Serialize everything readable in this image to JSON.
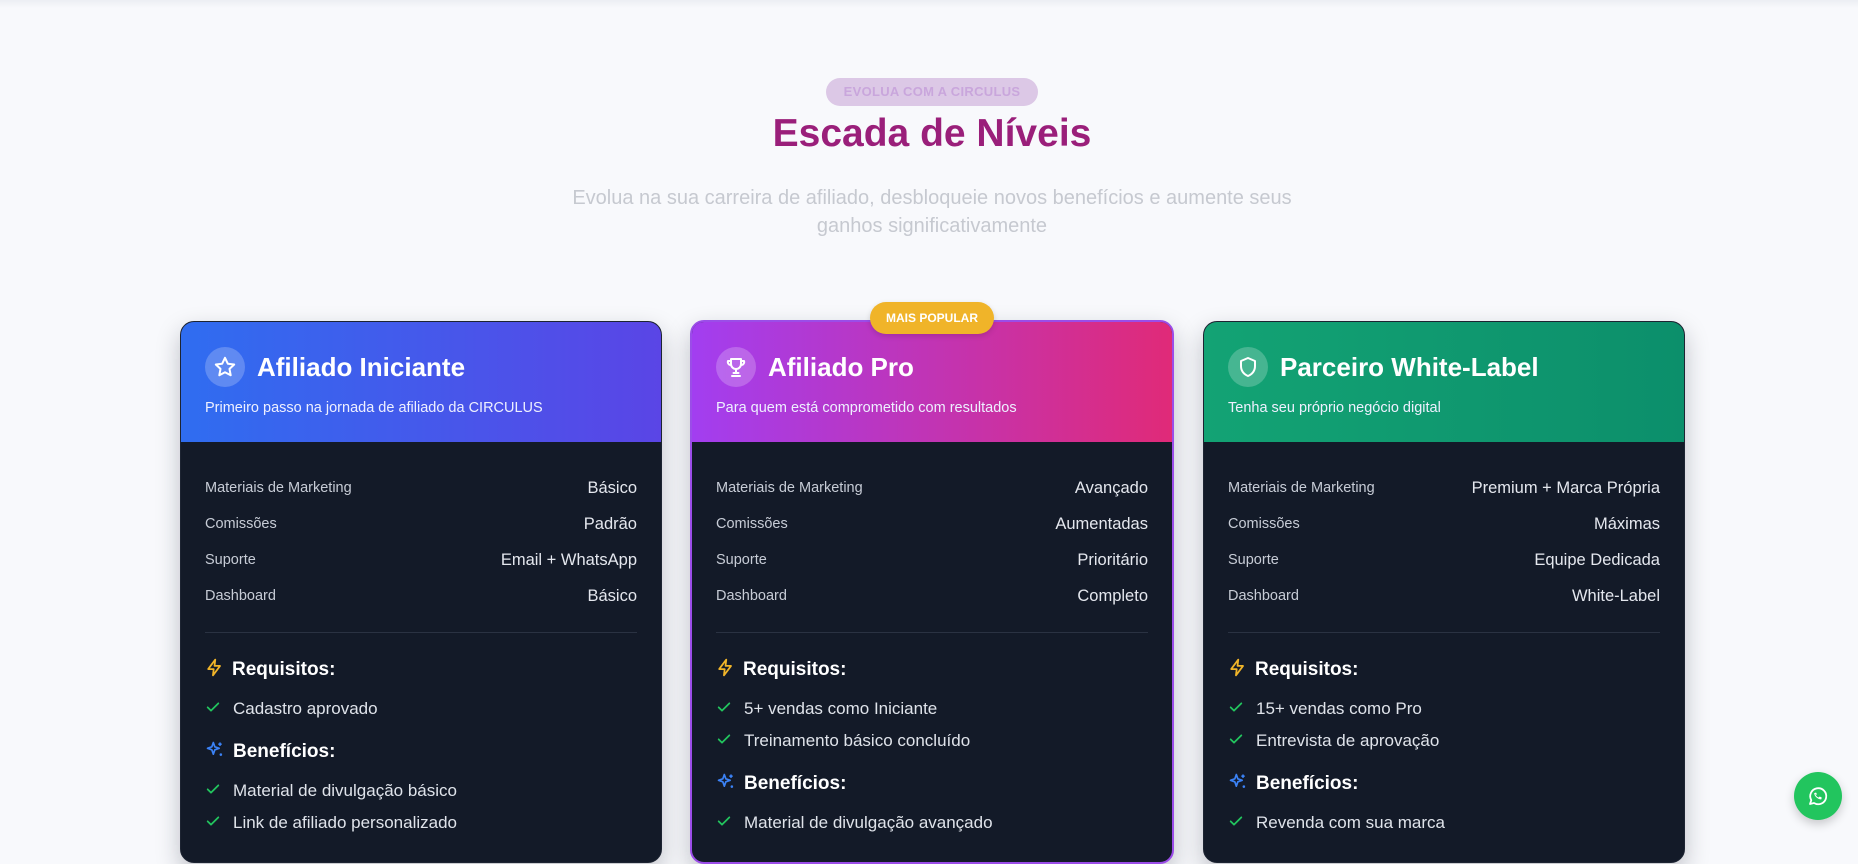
{
  "header": {
    "eyebrow": "EVOLUA COM A CIRCULUS",
    "title": "Escada de Níveis",
    "subtitle": "Evolua na sua carreira de afiliado, desbloqueie novos benefícios e aumente seus ganhos significativamente"
  },
  "popular_badge": "MAIS POPULAR",
  "cards": [
    {
      "icon": "star-icon",
      "title": "Afiliado Iniciante",
      "description": "Primeiro passo na jornada de afiliado da CIRCULUS",
      "gradient": [
        "#2f6df0",
        "#5a45e6"
      ],
      "rows": [
        {
          "k": "Materiais de Marketing",
          "v": "Básico"
        },
        {
          "k": "Comissões",
          "v": "Padrão"
        },
        {
          "k": "Suporte",
          "v": "Email + WhatsApp"
        },
        {
          "k": "Dashboard",
          "v": "Básico"
        }
      ],
      "requirements_title": "Requisitos:",
      "requirements": [
        "Cadastro aprovado"
      ],
      "benefits_title": "Benefícios:",
      "benefits": [
        "Material de divulgação básico",
        "Link de afiliado personalizado"
      ]
    },
    {
      "icon": "trophy-icon",
      "title": "Afiliado Pro",
      "description": "Para quem está comprometido com resultados",
      "gradient": [
        "#a23ef0",
        "#e02a78"
      ],
      "rows": [
        {
          "k": "Materiais de Marketing",
          "v": "Avançado"
        },
        {
          "k": "Comissões",
          "v": "Aumentadas"
        },
        {
          "k": "Suporte",
          "v": "Prioritário"
        },
        {
          "k": "Dashboard",
          "v": "Completo"
        }
      ],
      "requirements_title": "Requisitos:",
      "requirements": [
        "5+ vendas como Iniciante",
        "Treinamento básico concluído"
      ],
      "benefits_title": "Benefícios:",
      "benefits": [
        "Material de divulgação avançado"
      ]
    },
    {
      "icon": "shield-icon",
      "title": "Parceiro White-Label",
      "description": "Tenha seu próprio negócio digital",
      "gradient": [
        "#13a374",
        "#0c8f6b"
      ],
      "rows": [
        {
          "k": "Materiais de Marketing",
          "v": "Premium + Marca Própria"
        },
        {
          "k": "Comissões",
          "v": "Máximas"
        },
        {
          "k": "Suporte",
          "v": "Equipe Dedicada"
        },
        {
          "k": "Dashboard",
          "v": "White-Label"
        }
      ],
      "requirements_title": "Requisitos:",
      "requirements": [
        "15+ vendas como Pro",
        "Entrevista de aprovação"
      ],
      "benefits_title": "Benefícios:",
      "benefits": [
        "Revenda com sua marca"
      ]
    }
  ],
  "colors": {
    "title": "#9a1f7a",
    "check": "#22c55e",
    "bolt": "#f0b429",
    "sparkle": "#3b82f6",
    "whatsapp": "#22c55e"
  },
  "floating_button": "whatsapp-icon"
}
